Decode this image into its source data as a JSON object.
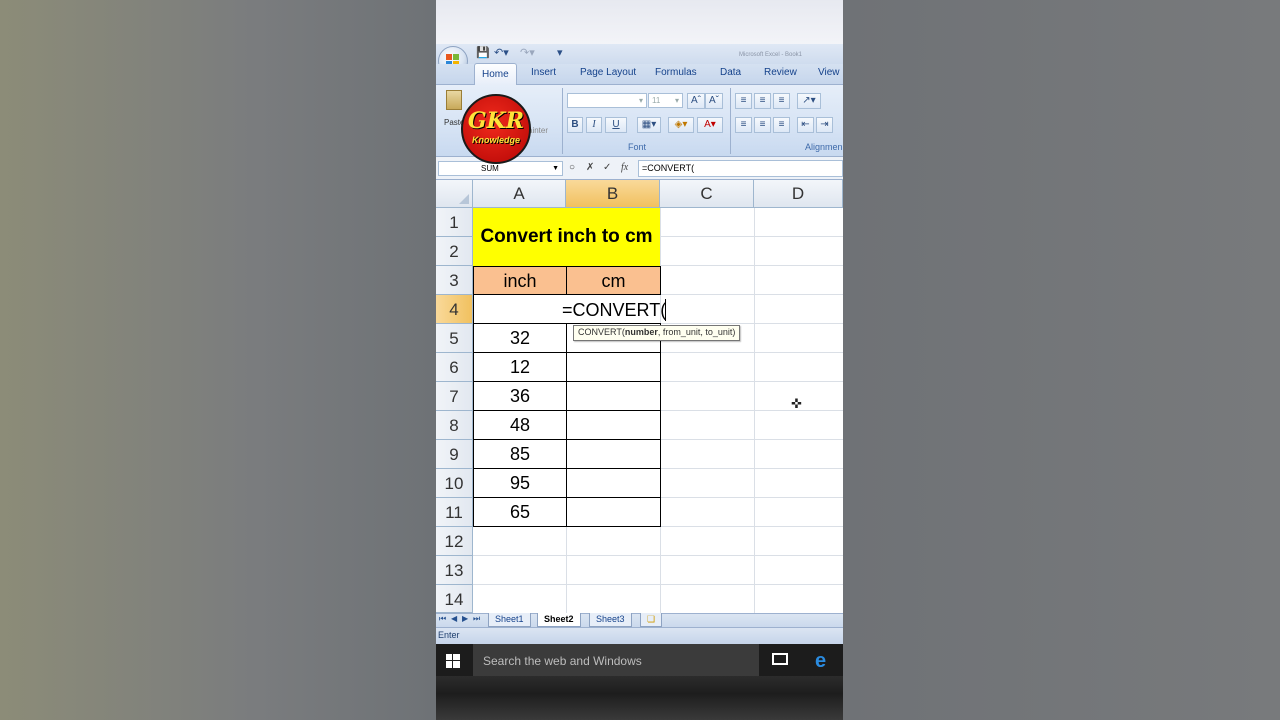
{
  "quick_access": {
    "undo_icon": "undo-icon",
    "redo_icon": "redo-icon",
    "save_icon": "save-icon",
    "title": "Microsoft Excel - Book1"
  },
  "tabs": [
    {
      "label": "Home",
      "active": true
    },
    {
      "label": "Insert"
    },
    {
      "label": "Page Layout"
    },
    {
      "label": "Formulas"
    },
    {
      "label": "Data"
    },
    {
      "label": "Review"
    },
    {
      "label": "View"
    }
  ],
  "ribbon": {
    "paste_label": "Paste",
    "painter_label": "ainter",
    "font_size": "11",
    "font_group_label": "Font",
    "alignment_group_label": "Alignmen",
    "bold": "B",
    "italic": "I",
    "underline": "U"
  },
  "logo": {
    "line1": "GKR",
    "line2": "Knowledge"
  },
  "formula_bar": {
    "name_box": "SUM",
    "formula": "=CONVERT("
  },
  "columns": [
    "A",
    "B",
    "C",
    "D"
  ],
  "rows": [
    "1",
    "2",
    "3",
    "4",
    "5",
    "6",
    "7",
    "8",
    "9",
    "10",
    "11",
    "12",
    "13",
    "14"
  ],
  "selected_column": "B",
  "selected_row": "4",
  "sheet": {
    "title": "Convert inch to cm",
    "header_inch": "inch",
    "header_cm": "cm",
    "editing_text": "=CONVERT(",
    "values": [
      "32",
      "12",
      "36",
      "48",
      "85",
      "95",
      "65"
    ]
  },
  "tooltip": {
    "fn": "CONVERT(",
    "arg_bold": "number",
    "rest": ", from_unit, to_unit)"
  },
  "sheet_tabs": [
    {
      "label": "Sheet1"
    },
    {
      "label": "Sheet2",
      "active": true
    },
    {
      "label": "Sheet3"
    }
  ],
  "status": "Enter",
  "taskbar": {
    "search_placeholder": "Search the web and Windows"
  },
  "colors": {
    "title_fill": "#ffff00",
    "header_fill": "#fac090",
    "selection": "#f1c15f"
  }
}
